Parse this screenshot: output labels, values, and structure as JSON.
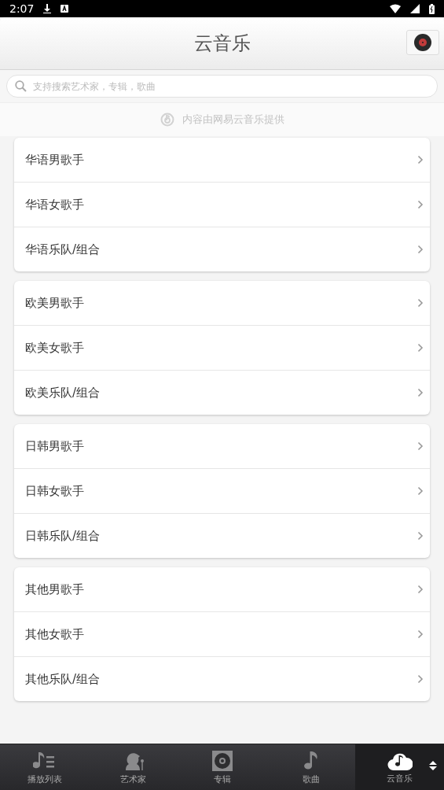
{
  "status_bar": {
    "time": "2:07"
  },
  "header": {
    "title": "云音乐"
  },
  "search": {
    "placeholder": "支持搜索艺术家，专辑，歌曲"
  },
  "credit": "内容由网易云音乐提供",
  "groups": [
    {
      "items": [
        "华语男歌手",
        "华语女歌手",
        "华语乐队/组合"
      ]
    },
    {
      "items": [
        "欧美男歌手",
        "欧美女歌手",
        "欧美乐队/组合"
      ]
    },
    {
      "items": [
        "日韩男歌手",
        "日韩女歌手",
        "日韩乐队/组合"
      ]
    },
    {
      "items": [
        "其他男歌手",
        "其他女歌手",
        "其他乐队/组合"
      ]
    }
  ],
  "tabs": [
    {
      "label": "播放列表",
      "kind": "playlist",
      "selected": false
    },
    {
      "label": "艺术家",
      "kind": "artist",
      "selected": false
    },
    {
      "label": "专辑",
      "kind": "album",
      "selected": false
    },
    {
      "label": "歌曲",
      "kind": "song",
      "selected": false
    },
    {
      "label": "云音乐",
      "kind": "cloud",
      "selected": true
    }
  ]
}
